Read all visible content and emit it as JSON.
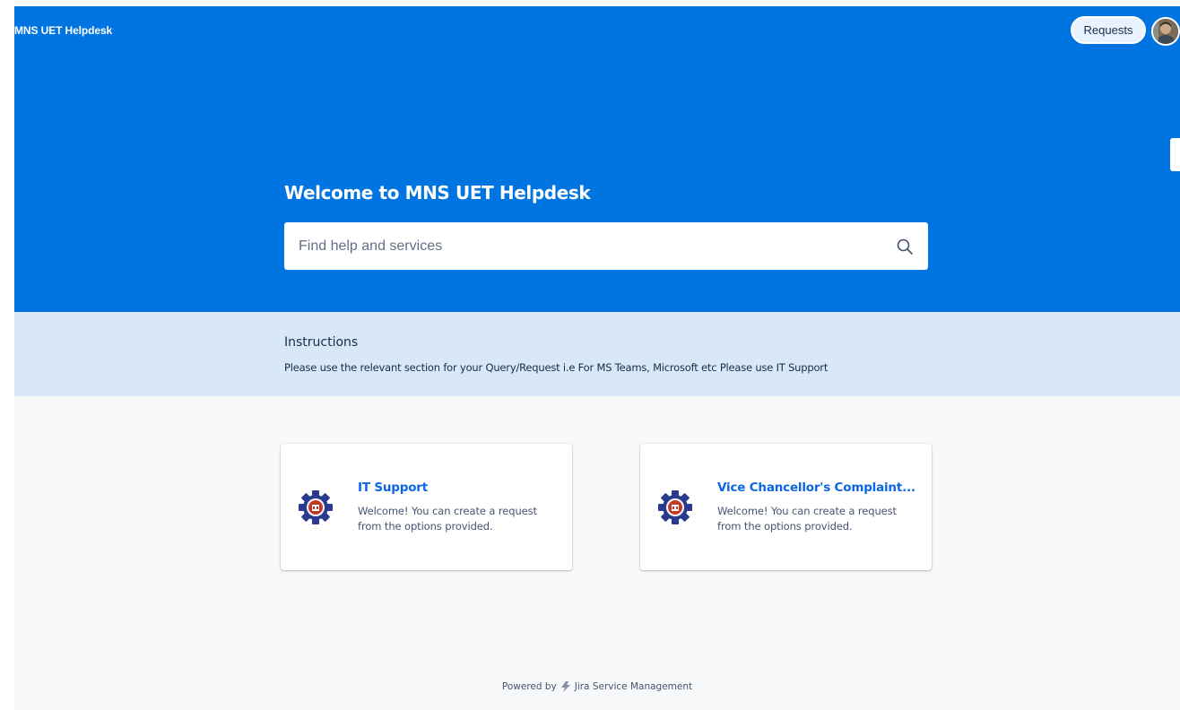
{
  "header": {
    "brand": "MNS UET Helpdesk",
    "requests_label": "Requests",
    "avatar_icon": "user-avatar"
  },
  "hero": {
    "title": "Welcome to MNS UET Helpdesk",
    "search_placeholder": "Find help and services",
    "search_value": "",
    "search_icon": "search-icon"
  },
  "instructions": {
    "title": "Instructions",
    "text": "Please use the relevant section for your Query/Request i.e For MS Teams, Microsoft etc Please use IT Support"
  },
  "portals": [
    {
      "title": "IT Support",
      "description": "Welcome! You can create a request from the options provided.",
      "icon": "university-gear-logo-icon"
    },
    {
      "title": "Vice Chancellor's Complaint...",
      "description": "Welcome! You can create a request from the options provided.",
      "icon": "university-gear-logo-icon"
    }
  ],
  "footer": {
    "powered_by": "Powered by",
    "product": "Jira Service Management",
    "product_icon": "jira-lightning-icon"
  },
  "colors": {
    "hero_blue": "#0074e0",
    "instructions_bg": "#d9e8f7",
    "link_blue": "#0c66e4",
    "page_bg": "#f7f8f9"
  }
}
